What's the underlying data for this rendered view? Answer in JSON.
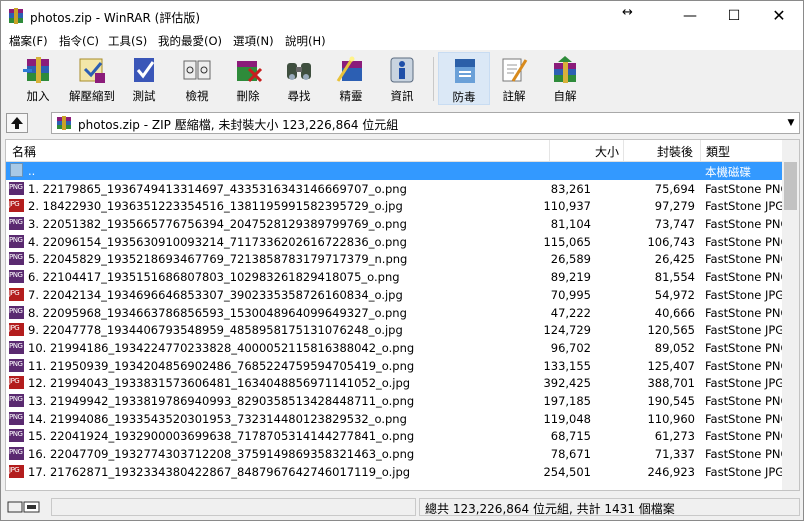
{
  "window": {
    "title": "photos.zip - WinRAR (評估版)",
    "move_glyph": "↔",
    "minimize_glyph": "—",
    "maximize_glyph": "☐",
    "close_glyph": "✕"
  },
  "menu": [
    "檔案(F)",
    "指令(C)",
    "工具(S)",
    "我的最愛(O)",
    "選項(N)",
    "說明(H)"
  ],
  "toolbar": [
    {
      "label": "加入",
      "icon": "add-archive-icon"
    },
    {
      "label": "解壓縮到",
      "icon": "extract-to-icon"
    },
    {
      "label": "測試",
      "icon": "test-icon"
    },
    {
      "label": "檢視",
      "icon": "view-icon"
    },
    {
      "label": "刪除",
      "icon": "delete-icon"
    },
    {
      "label": "尋找",
      "icon": "find-icon"
    },
    {
      "label": "精靈",
      "icon": "wizard-icon"
    },
    {
      "label": "資訊",
      "icon": "info-icon"
    },
    {
      "label": "防毒",
      "icon": "virus-scan-icon"
    },
    {
      "label": "註解",
      "icon": "comment-icon"
    },
    {
      "label": "自解",
      "icon": "sfx-icon"
    }
  ],
  "address": {
    "text": "photos.zip - ZIP 壓縮檔, 未封裝大小 123,226,864 位元組"
  },
  "columns": {
    "name": "名稱",
    "size": "大小",
    "packed": "封裝後",
    "type": "類型"
  },
  "parent_row": {
    "name": "..",
    "type": "本機磁碟"
  },
  "files": [
    {
      "name": "1. 22179865_1936749413314697_4335316343146669707_o.png",
      "size": "83,261",
      "packed": "75,694",
      "type": "FastStone PNG",
      "ext": "png"
    },
    {
      "name": "2. 18422930_1936351223354516_1381195991582395729_o.jpg",
      "size": "110,937",
      "packed": "97,279",
      "type": "FastStone JPG",
      "ext": "jpg"
    },
    {
      "name": "3. 22051382_1935665776756394_2047528129389799769_o.png",
      "size": "81,104",
      "packed": "73,747",
      "type": "FastStone PNG",
      "ext": "png"
    },
    {
      "name": "4. 22096154_1935630910093214_7117336202616722836_o.png",
      "size": "115,065",
      "packed": "106,743",
      "type": "FastStone PNG",
      "ext": "png"
    },
    {
      "name": "5. 22045829_1935218693467769_7213858783179717379_n.png",
      "size": "26,589",
      "packed": "26,425",
      "type": "FastStone PNG",
      "ext": "png"
    },
    {
      "name": "6. 22104417_1935151686807803_102983261829418075_o.png",
      "size": "89,219",
      "packed": "81,554",
      "type": "FastStone PNG",
      "ext": "png"
    },
    {
      "name": "7. 22042134_1934696646853307_3902335358726160834_o.jpg",
      "size": "70,995",
      "packed": "54,972",
      "type": "FastStone JPG",
      "ext": "jpg"
    },
    {
      "name": "8. 22095968_1934663786856593_1530048964099649327_o.png",
      "size": "47,222",
      "packed": "40,666",
      "type": "FastStone PNG",
      "ext": "png"
    },
    {
      "name": "9. 22047778_1934406793548959_4858958175131076248_o.jpg",
      "size": "124,729",
      "packed": "120,565",
      "type": "FastStone JPG",
      "ext": "jpg"
    },
    {
      "name": "10. 21994186_1934224770233828_4000052115816388042_o.png",
      "size": "96,702",
      "packed": "89,052",
      "type": "FastStone PNG",
      "ext": "png"
    },
    {
      "name": "11. 21950939_1934204856902486_7685224759594705419_o.png",
      "size": "133,155",
      "packed": "125,407",
      "type": "FastStone PNG",
      "ext": "png"
    },
    {
      "name": "12. 21994043_1933831573606481_1634048856971141052_o.jpg",
      "size": "392,425",
      "packed": "388,701",
      "type": "FastStone JPG",
      "ext": "jpg"
    },
    {
      "name": "13. 21949942_1933819786940993_8290358513428448711_o.png",
      "size": "197,185",
      "packed": "190,545",
      "type": "FastStone PNG",
      "ext": "png"
    },
    {
      "name": "14. 21994086_1933543520301953_732314480123829532_o.png",
      "size": "119,048",
      "packed": "110,960",
      "type": "FastStone PNG",
      "ext": "png"
    },
    {
      "name": "15. 22041924_1932900003699638_7178705314144277841_o.png",
      "size": "68,715",
      "packed": "61,273",
      "type": "FastStone PNG",
      "ext": "png"
    },
    {
      "name": "16. 22047709_1932774303712208_3759149869358321463_o.png",
      "size": "78,671",
      "packed": "71,337",
      "type": "FastStone PNG",
      "ext": "png"
    },
    {
      "name": "17. 21762871_1932334380422867_8487967642746017119_o.jpg",
      "size": "254,501",
      "packed": "246,923",
      "type": "FastStone JPG",
      "ext": "jpg"
    }
  ],
  "status": {
    "left": "",
    "right": "總共 123,226,864 位元組, 共計 1431 個檔案"
  },
  "colors": {
    "selection": "#3399ff",
    "png_icon": "#5a2a70",
    "jpg_icon": "#b31d1d"
  }
}
